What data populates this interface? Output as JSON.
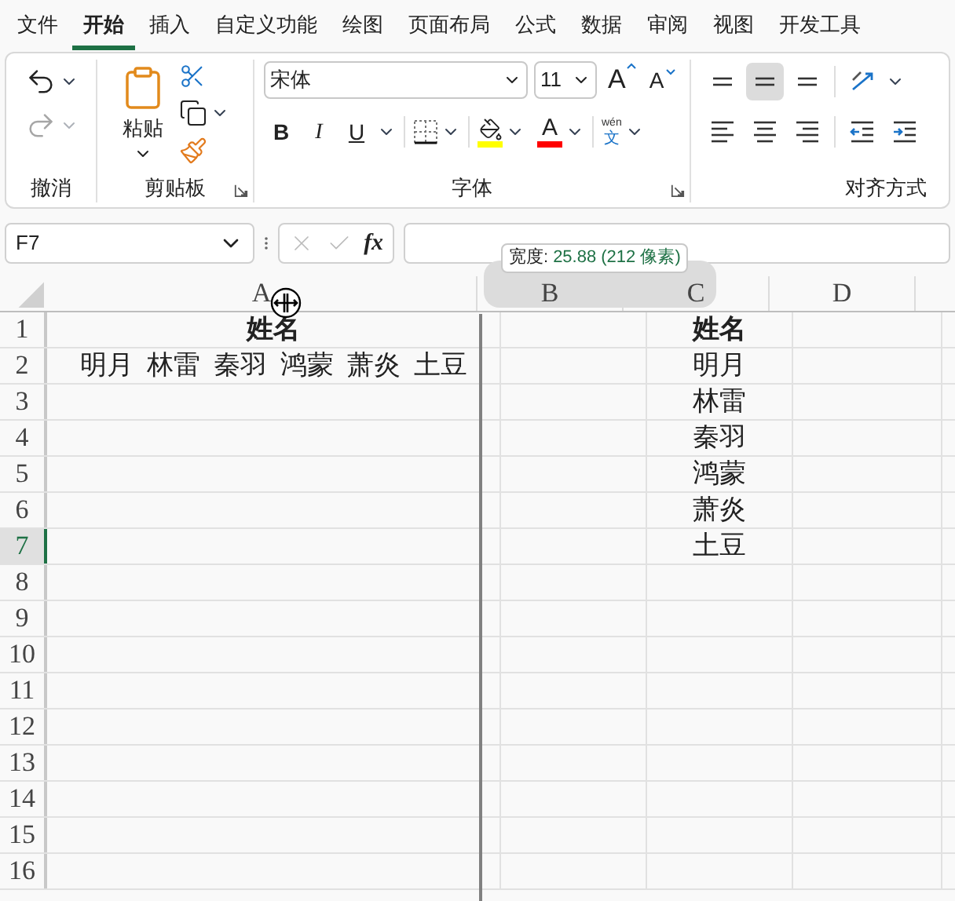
{
  "menu_tabs": [
    {
      "label": "文件",
      "selected": false
    },
    {
      "label": "开始",
      "selected": true
    },
    {
      "label": "插入",
      "selected": false
    },
    {
      "label": "自定义功能",
      "selected": false
    },
    {
      "label": "绘图",
      "selected": false
    },
    {
      "label": "页面布局",
      "selected": false
    },
    {
      "label": "公式",
      "selected": false
    },
    {
      "label": "数据",
      "selected": false
    },
    {
      "label": "审阅",
      "selected": false
    },
    {
      "label": "视图",
      "selected": false
    },
    {
      "label": "开发工具",
      "selected": false
    }
  ],
  "ribbon": {
    "undo_group": {
      "label": "撤消",
      "redo_disabled": true
    },
    "clipboard_group": {
      "label": "剪贴板",
      "paste": "粘贴"
    },
    "font_group": {
      "label": "字体",
      "font_name": "宋体",
      "font_size": "11",
      "grow": "A",
      "shrink": "A",
      "bold": "B",
      "italic": "I",
      "underline": "U",
      "font_color": "A",
      "phonetic_top": "wén",
      "phonetic_bottom": "文"
    },
    "align_group": {
      "label": "对齐方式",
      "buttons": [
        {
          "kind": "top",
          "selected": false
        },
        {
          "kind": "middle",
          "selected": true
        },
        {
          "kind": "bottom",
          "selected": false
        },
        {
          "kind": "orientation",
          "selected": false
        },
        {
          "kind": "left",
          "selected": false
        },
        {
          "kind": "center",
          "selected": false
        },
        {
          "kind": "right",
          "selected": false
        },
        {
          "kind": "outdent",
          "selected": false
        },
        {
          "kind": "indent",
          "selected": false
        }
      ]
    }
  },
  "name_box": "F7",
  "formula_bar": {
    "fx": "fx"
  },
  "tooltip": {
    "label": "宽度:",
    "value": "25.88 (212 像素)"
  },
  "sheet": {
    "columns": [
      "A",
      "B",
      "C",
      "D"
    ],
    "rows": [
      {
        "label": "1",
        "selected": false,
        "bold": true,
        "A": "姓名",
        "C": "姓名"
      },
      {
        "label": "2",
        "selected": false,
        "bold": false,
        "A": "明月  林雷  秦羽  鸿蒙  萧炎  土豆",
        "C": "明月"
      },
      {
        "label": "3",
        "selected": false,
        "bold": false,
        "C": "林雷"
      },
      {
        "label": "4",
        "selected": false,
        "bold": false,
        "C": "秦羽"
      },
      {
        "label": "5",
        "selected": false,
        "bold": false,
        "C": "鸿蒙"
      },
      {
        "label": "6",
        "selected": false,
        "bold": false,
        "C": "萧炎"
      },
      {
        "label": "7",
        "selected": true,
        "bold": false,
        "C": "土豆"
      },
      {
        "label": "8",
        "selected": false
      },
      {
        "label": "9",
        "selected": false
      },
      {
        "label": "10",
        "selected": false
      },
      {
        "label": "11",
        "selected": false
      },
      {
        "label": "12",
        "selected": false
      },
      {
        "label": "13",
        "selected": false
      },
      {
        "label": "14",
        "selected": false
      },
      {
        "label": "15",
        "selected": false
      },
      {
        "label": "16",
        "selected": false
      }
    ]
  }
}
